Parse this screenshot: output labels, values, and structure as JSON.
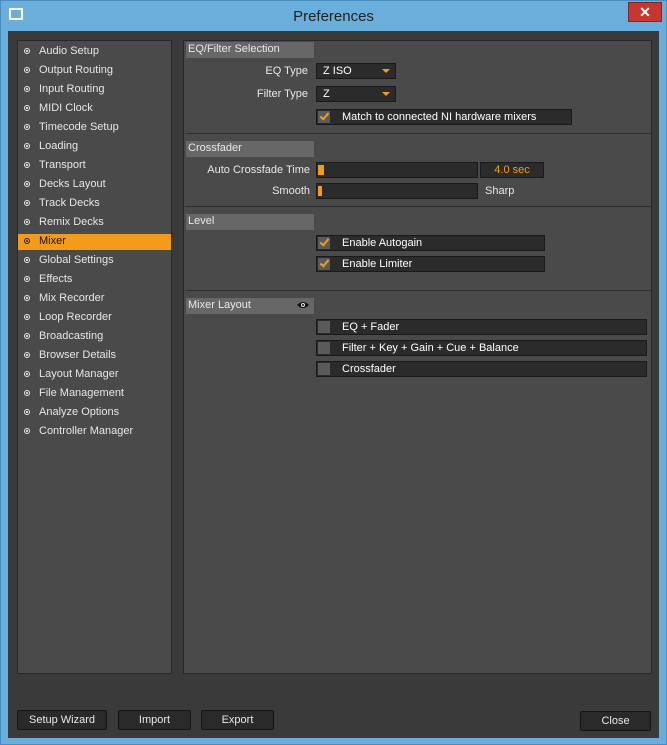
{
  "window": {
    "title": "Preferences"
  },
  "sidebar": {
    "items": [
      {
        "label": "Audio Setup",
        "active": false
      },
      {
        "label": "Output Routing",
        "active": false
      },
      {
        "label": "Input Routing",
        "active": false
      },
      {
        "label": "MIDI Clock",
        "active": false
      },
      {
        "label": "Timecode Setup",
        "active": false
      },
      {
        "label": "Loading",
        "active": false
      },
      {
        "label": "Transport",
        "active": false
      },
      {
        "label": "Decks Layout",
        "active": false
      },
      {
        "label": "Track Decks",
        "active": false
      },
      {
        "label": "Remix Decks",
        "active": false
      },
      {
        "label": "Mixer",
        "active": true
      },
      {
        "label": "Global Settings",
        "active": false
      },
      {
        "label": "Effects",
        "active": false
      },
      {
        "label": "Mix Recorder",
        "active": false
      },
      {
        "label": "Loop Recorder",
        "active": false
      },
      {
        "label": "Broadcasting",
        "active": false
      },
      {
        "label": "Browser Details",
        "active": false
      },
      {
        "label": "Layout Manager",
        "active": false
      },
      {
        "label": "File Management",
        "active": false
      },
      {
        "label": "Analyze Options",
        "active": false
      },
      {
        "label": "Controller Manager",
        "active": false
      }
    ]
  },
  "eq_filter": {
    "heading": "EQ/Filter Selection",
    "eq_type_label": "EQ Type",
    "eq_type_value": "Z ISO",
    "filter_type_label": "Filter Type",
    "filter_type_value": "Z",
    "match_label": "Match to connected NI hardware mixers",
    "match_checked": true
  },
  "crossfader": {
    "heading": "Crossfader",
    "auto_label": "Auto Crossfade Time",
    "auto_value": "4.0 sec",
    "auto_level": 0.04,
    "smooth_label": "Smooth",
    "sharp_label": "Sharp",
    "curve_level": 0.0
  },
  "level": {
    "heading": "Level",
    "autogain_label": "Enable Autogain",
    "autogain_checked": true,
    "limiter_label": "Enable Limiter",
    "limiter_checked": true
  },
  "mixer_layout": {
    "heading": "Mixer Layout",
    "icon": "eye-icon",
    "options": [
      {
        "label": "EQ + Fader",
        "checked": false
      },
      {
        "label": "Filter + Key + Gain + Cue + Balance",
        "checked": false
      },
      {
        "label": "Crossfader",
        "checked": false
      }
    ]
  },
  "footer": {
    "setup_wizard": "Setup Wizard",
    "import": "Import",
    "export": "Export",
    "close": "Close"
  },
  "colors": {
    "accent": "#f39c1c",
    "panel": "#4a4a4a",
    "background": "#3a3a3a",
    "titlebar": "#6aaedb"
  }
}
